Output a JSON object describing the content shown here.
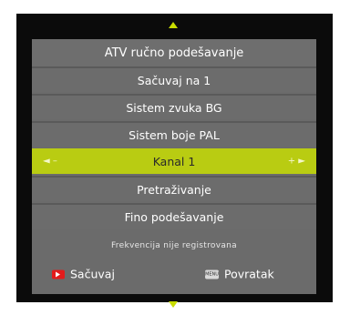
{
  "title": "ATV ručno podešavanje",
  "menu": [
    {
      "label": "Sačuvaj na 1",
      "active": false
    },
    {
      "label": "Sistem zvuka BG",
      "active": false
    },
    {
      "label": "Sistem boje PAL",
      "active": false
    },
    {
      "label": "Kanal 1",
      "active": true,
      "left_control": "◄ –",
      "right_control": "+ ►"
    },
    {
      "label": "Pretraživanje",
      "active": false
    },
    {
      "label": "Fino podešavanje",
      "active": false
    }
  ],
  "status": "Frekvencija nije registrovana",
  "footer": {
    "save_label": "Sačuvaj",
    "back_label": "Povratak",
    "menu_key_text": "MENU"
  },
  "colors": {
    "accent": "#b9cc12",
    "panel": "#6b6b6b",
    "red_key": "#e31b1b"
  }
}
